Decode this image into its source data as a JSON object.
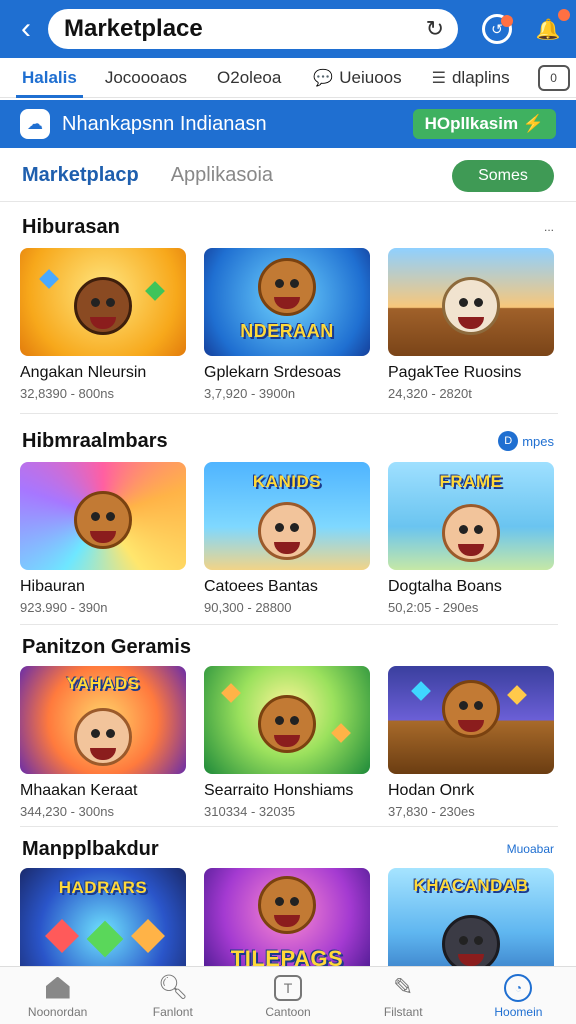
{
  "header": {
    "title": "Marketplace",
    "back_icon": "chevron-left-icon",
    "refresh_icon": "refresh-icon",
    "icons": [
      "refresh-circle-icon",
      "bell-icon"
    ]
  },
  "tabs": [
    {
      "label": "Halalis",
      "active": true
    },
    {
      "label": "Jocoooaos"
    },
    {
      "label": "O2oleoa"
    },
    {
      "label": "Ueiuoos",
      "icon": "chat-icon"
    },
    {
      "label": "dlaplins",
      "icon": "list-icon"
    },
    {
      "label": "0",
      "icon": "square-icon"
    }
  ],
  "banner": {
    "text": "Nhankapsnn Indianasn",
    "button": "HOpllkasim"
  },
  "segment": {
    "primary": "Marketplacp",
    "secondary": "Applikasoia",
    "button": "Somes"
  },
  "sections": [
    {
      "title": "Hiburasan",
      "more": "...",
      "items": [
        {
          "name": "Angakan Nleursin",
          "meta": "32,8390 - 800ns",
          "art": ""
        },
        {
          "name": "Gplekarn Srdesoas",
          "meta": "3,7,920 - 3900n",
          "art": "NDERAAN"
        },
        {
          "name": "PagakTee Ruosins",
          "meta": "24,320 - 2820t",
          "art": ""
        }
      ]
    },
    {
      "title": "Hibmraalmbars",
      "more": "mpes",
      "items": [
        {
          "name": "Hibauran",
          "meta": "923.990 - 390n",
          "art": ""
        },
        {
          "name": "Catoees Bantas",
          "meta": "90,300 - 28800",
          "art": "KANIDS"
        },
        {
          "name": "Dogtalha Boans",
          "meta": "50,2:05 - 290es",
          "art": "FRAME"
        }
      ]
    },
    {
      "title": "Panitzon Geramis",
      "more": "",
      "items": [
        {
          "name": "Mhaakan Keraat",
          "meta": "344,230 - 300ns",
          "art": "YAHADS"
        },
        {
          "name": "Searraito Honshiams",
          "meta": "310334 - 32035",
          "art": ""
        },
        {
          "name": "Hodan Onrk",
          "meta": "37,830 - 230es",
          "art": ""
        }
      ]
    },
    {
      "title": "Manpplbakdur",
      "more": "Muoabar",
      "items": [
        {
          "name": "",
          "meta": "",
          "art": "HADRARS"
        },
        {
          "name": "",
          "meta": "",
          "art": "TILEPAGS"
        },
        {
          "name": "",
          "meta": "",
          "art": "KHACANDAB"
        }
      ]
    }
  ],
  "bottom_nav": [
    {
      "label": "Noonordan",
      "icon": "home-icon"
    },
    {
      "label": "Fanlont",
      "icon": "search-icon"
    },
    {
      "label": "Cantoon",
      "icon": "box-icon"
    },
    {
      "label": "Filstant",
      "icon": "pen-icon"
    },
    {
      "label": "Hoomein",
      "icon": "profile-circle-icon",
      "active": true
    }
  ],
  "colors": {
    "accent": "#1f6fd1",
    "green": "#3fb160",
    "text": "#111111"
  }
}
